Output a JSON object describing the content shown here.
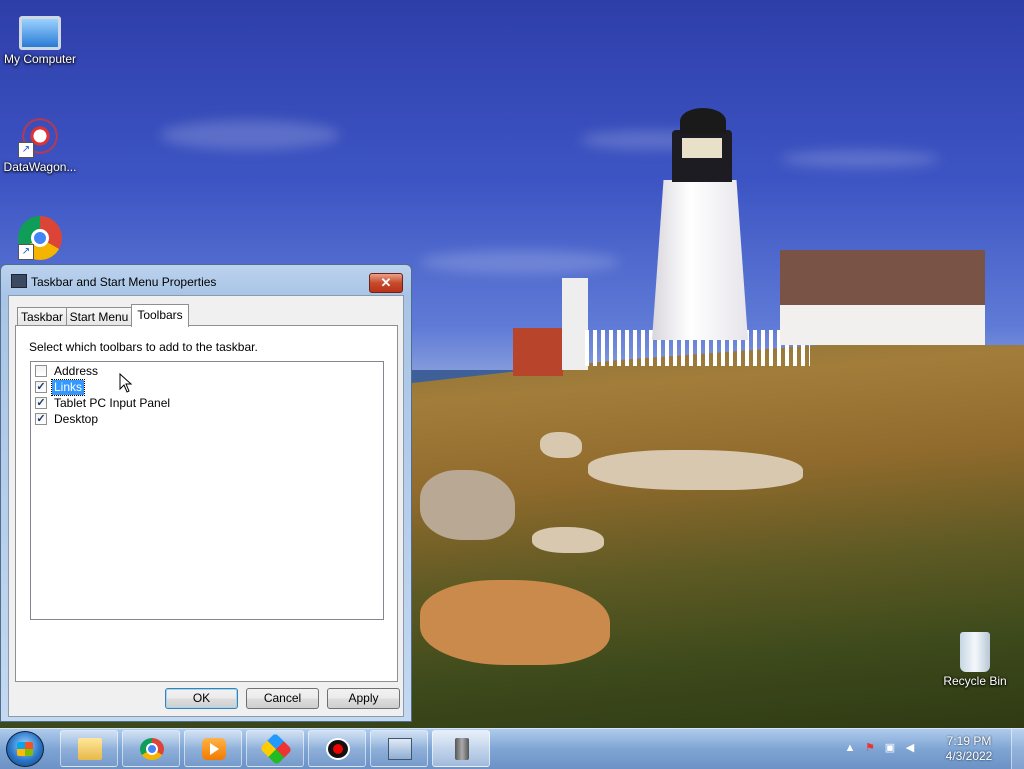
{
  "desktop": {
    "icons": [
      {
        "label": "My Computer",
        "icon": "computer-icon"
      },
      {
        "label": "DataWagon...",
        "icon": "datawagon-icon"
      },
      {
        "label": "",
        "icon": "chrome-icon"
      },
      {
        "label": "Recycle Bin",
        "icon": "recycle-bin-icon"
      }
    ]
  },
  "dialog": {
    "title": "Taskbar and Start Menu Properties",
    "close_label": "✕",
    "tabs": [
      {
        "label": "Taskbar",
        "active": false
      },
      {
        "label": "Start Menu",
        "active": false
      },
      {
        "label": "Toolbars",
        "active": true
      }
    ],
    "instruction": "Select which toolbars to add to the taskbar.",
    "toolbars": [
      {
        "label": "Address",
        "checked": false,
        "selected": false
      },
      {
        "label": "Links",
        "checked": true,
        "selected": true
      },
      {
        "label": "Tablet PC Input Panel",
        "checked": true,
        "selected": false
      },
      {
        "label": "Desktop",
        "checked": true,
        "selected": false
      }
    ],
    "buttons": {
      "ok": "OK",
      "cancel": "Cancel",
      "apply": "Apply"
    }
  },
  "taskbar": {
    "pinned": [
      {
        "icon": "windows-explorer-icon",
        "active": false
      },
      {
        "icon": "chrome-icon",
        "active": false
      },
      {
        "icon": "media-player-icon",
        "active": false
      },
      {
        "icon": "photos-icon",
        "active": false
      },
      {
        "icon": "record-icon",
        "active": false
      },
      {
        "icon": "control-panel-icon",
        "active": false
      },
      {
        "icon": "server-icon",
        "active": true
      }
    ],
    "tray": {
      "time": "7:19 PM",
      "date": "4/3/2022",
      "icons": [
        "chevron-up-icon",
        "action-center-flag-icon",
        "network-icon",
        "volume-icon"
      ]
    }
  }
}
